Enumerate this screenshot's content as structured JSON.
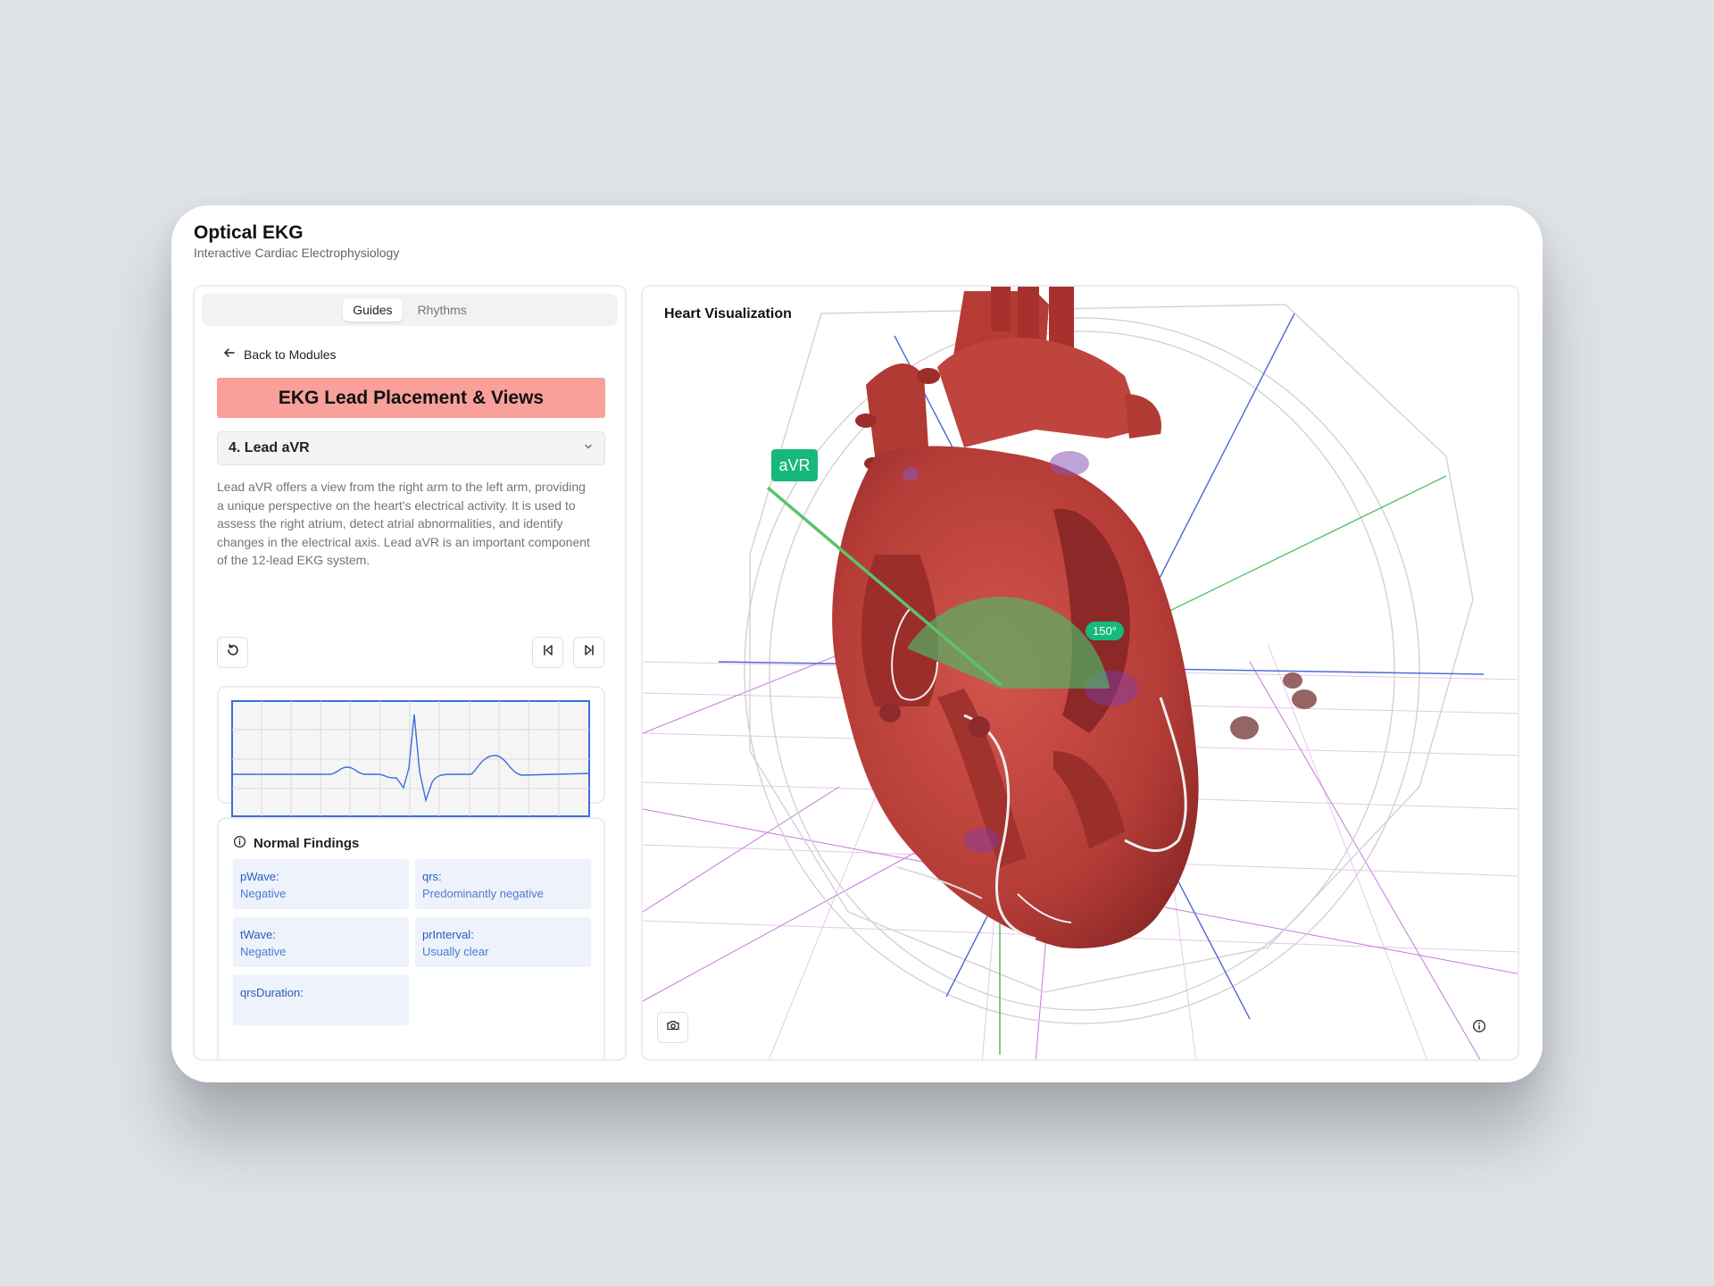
{
  "app": {
    "title": "Optical EKG",
    "subtitle": "Interactive Cardiac Electrophysiology"
  },
  "tabs": [
    {
      "label": "Guides",
      "active": true
    },
    {
      "label": "Rhythms",
      "active": false
    }
  ],
  "nav": {
    "back_label": "Back to Modules"
  },
  "module": {
    "title": "EKG Lead Placement & Views",
    "selected_lead": "4. Lead aVR",
    "description": "Lead aVR offers a view from the right arm to the left arm, providing a unique perspective on the heart's electrical activity. It is used to assess the right atrium, detect atrial abnormalities, and identify changes in the electrical axis. Lead aVR is an important component of the 12-lead EKG system."
  },
  "controls": {
    "reset_icon": "rotate-ccw-icon",
    "prev_icon": "skip-back-icon",
    "next_icon": "skip-forward-icon"
  },
  "findings": {
    "heading": "Normal Findings",
    "items": [
      {
        "key": "pWave:",
        "value": "Negative"
      },
      {
        "key": "qrs:",
        "value": "Predominantly negative"
      },
      {
        "key": "tWave:",
        "value": "Negative"
      },
      {
        "key": "prInterval:",
        "value": "Usually clear"
      },
      {
        "key": "qrsDuration:",
        "value": ""
      }
    ]
  },
  "visualization": {
    "title": "Heart Visualization",
    "lead_label": "aVR",
    "angle_label": "150°",
    "camera_icon": "camera-icon",
    "info_icon": "info-icon"
  },
  "colors": {
    "accent_green": "#17b87e",
    "module_title_bg": "#f9a09a",
    "heart_red": "#c0453f",
    "ekg_line": "#3b6fd8"
  }
}
